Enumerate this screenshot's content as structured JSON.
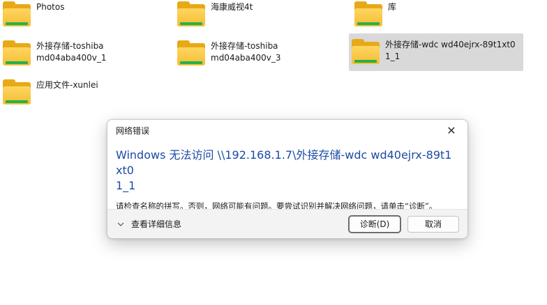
{
  "explorer": {
    "items": [
      {
        "label": "Photos"
      },
      {
        "label": "海康威视4t"
      },
      {
        "label": "库"
      },
      {
        "label": "外接存储-toshiba\nmd04aba400v_1"
      },
      {
        "label": "外接存储-toshiba\nmd04aba400v_3"
      },
      {
        "label": "外接存储-wdc wd40ejrx-89t1xt0\n1_1"
      },
      {
        "label": "应用文件-xunlei"
      }
    ]
  },
  "dialog": {
    "title": "网络错误",
    "headline": "Windows 无法访问 \\\\192.168.1.7\\外接存储-wdc wd40ejrx-89t1xt0\n1_1",
    "message": "请检查名称的拼写。否则，网络可能有问题。要尝试识别并解决网络问题，请单击“诊断”。",
    "details_label": "查看详细信息",
    "diagnose_label": "诊断(D)",
    "cancel_label": "取消"
  }
}
